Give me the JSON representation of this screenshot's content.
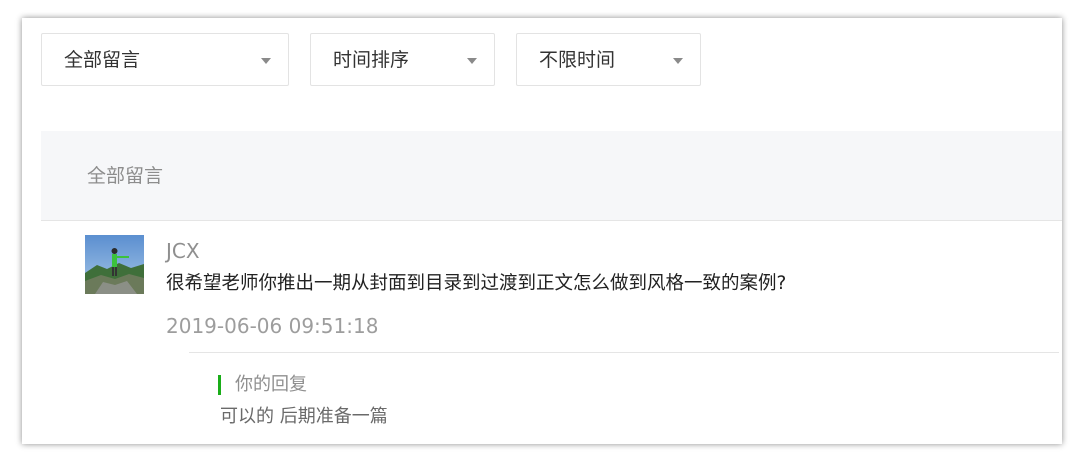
{
  "filters": {
    "type_filter": {
      "selected": "全部留言",
      "icon": "caret-down-icon"
    },
    "sort_filter": {
      "selected": "时间排序",
      "icon": "caret-down-icon"
    },
    "time_filter": {
      "selected": "不限时间",
      "icon": "caret-down-icon"
    }
  },
  "section": {
    "title": "全部留言"
  },
  "comments": [
    {
      "author": "JCX",
      "text": "很希望老师你推出一期从封面到目录到过渡到正文怎么做到风格一致的案例?",
      "time": "2019-06-06 09:51:18",
      "reply": {
        "label": "你的回复",
        "text": "可以的 后期准备一篇"
      }
    }
  ],
  "colors": {
    "accent": "#1aad19",
    "header_bg": "#f6f7f9",
    "border": "#e3e3e3"
  }
}
